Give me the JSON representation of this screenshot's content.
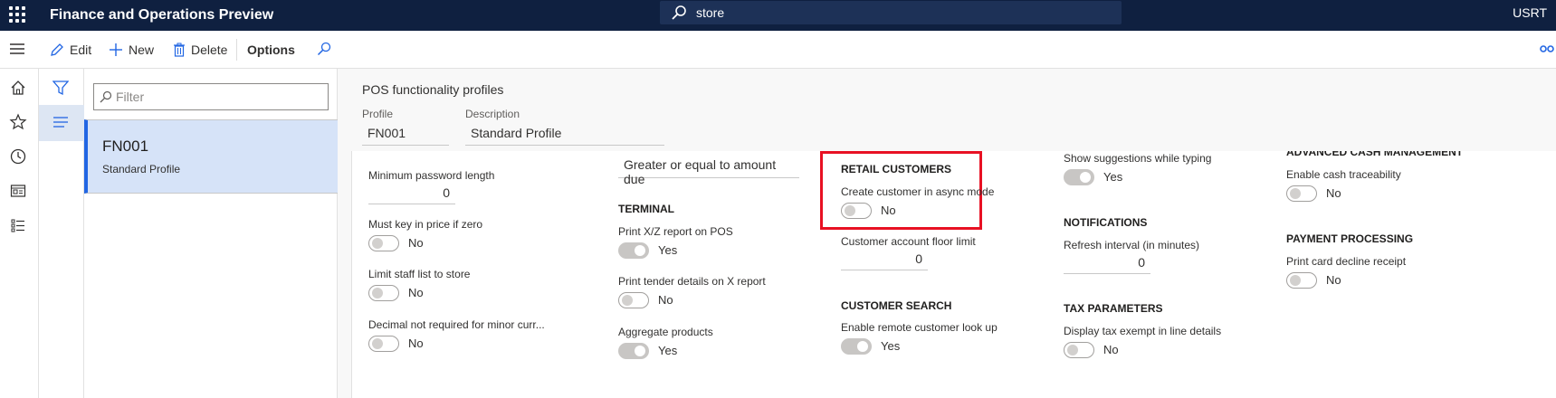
{
  "topbar": {
    "app_title": "Finance and Operations Preview",
    "search_value": "store",
    "user": "USRT"
  },
  "actions": {
    "edit": "Edit",
    "new": "New",
    "delete": "Delete",
    "options": "Options"
  },
  "list": {
    "filter_placeholder": "Filter",
    "items": [
      {
        "code": "FN001",
        "description": "Standard Profile"
      }
    ]
  },
  "detail": {
    "title": "POS functionality profiles",
    "profile_label": "Profile",
    "profile_value": "FN001",
    "description_label": "Description",
    "description_value": "Standard Profile",
    "col1": {
      "min_password_label": "Minimum password length",
      "min_password_value": "0",
      "key_price_label": "Must key in price if zero",
      "key_price_value": "No",
      "limit_staff_label": "Limit staff list to store",
      "limit_staff_value": "No",
      "decimal_label": "Decimal not required for minor curr...",
      "decimal_value": "No"
    },
    "col2": {
      "amount_due_value": "Greater or equal to amount due",
      "terminal_heading": "TERMINAL",
      "xz_label": "Print X/Z report on POS",
      "xz_value": "Yes",
      "tender_label": "Print tender details on X report",
      "tender_value": "No",
      "aggregate_label": "Aggregate products",
      "aggregate_value": "Yes"
    },
    "col3": {
      "retail_heading": "RETAIL CUSTOMERS",
      "async_label": "Create customer in async mode",
      "async_value": "No",
      "floor_label": "Customer account floor limit",
      "floor_value": "0",
      "search_heading": "CUSTOMER SEARCH",
      "remote_label": "Enable remote customer look up",
      "remote_value": "Yes"
    },
    "col4": {
      "suggest_label": "Show suggestions while typing",
      "suggest_value": "Yes",
      "notif_heading": "NOTIFICATIONS",
      "refresh_label": "Refresh interval (in minutes)",
      "refresh_value": "0",
      "tax_heading": "TAX PARAMETERS",
      "tax_label": "Display tax exempt in line details",
      "tax_value": "No"
    },
    "col5": {
      "cash_heading": "ADVANCED CASH MANAGEMENT",
      "trace_label": "Enable cash traceability",
      "trace_value": "No",
      "payment_heading": "PAYMENT PROCESSING",
      "decline_label": "Print card decline receipt",
      "decline_value": "No"
    }
  },
  "colors": {
    "topbar": "#0f2040",
    "accent": "#2266e3",
    "highlight": "#e81123"
  }
}
